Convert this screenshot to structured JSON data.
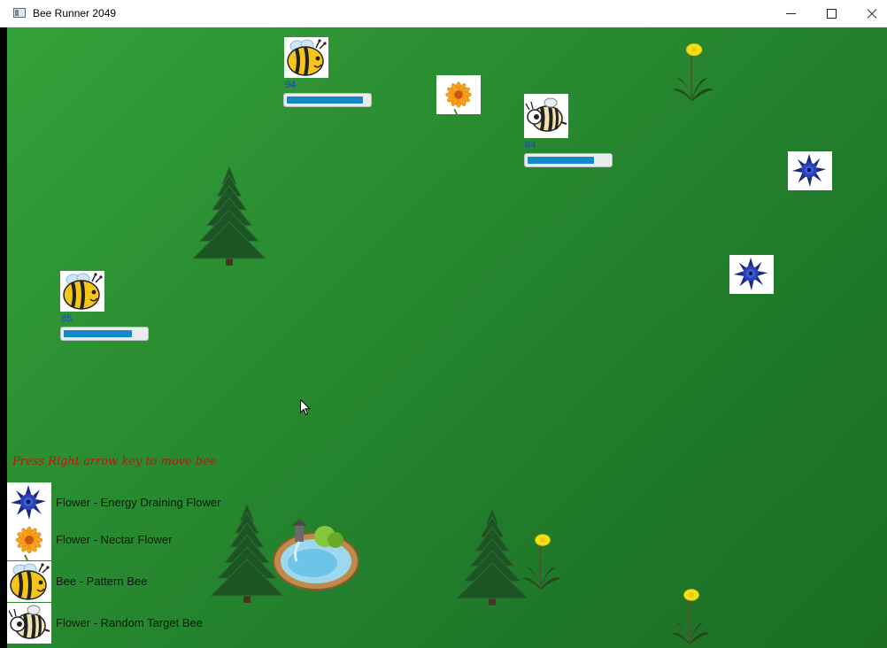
{
  "window": {
    "title": "Bee Runner 2049"
  },
  "bees": [
    {
      "type": "pattern",
      "energy": 94,
      "energy_label": "94",
      "fill": 0.94
    },
    {
      "type": "random-target",
      "energy": 84,
      "energy_label": "84",
      "fill": 0.82
    },
    {
      "type": "pattern",
      "energy": 85,
      "energy_label": "85",
      "fill": 0.84
    }
  ],
  "instruction": "Press Right arrow key to move bee",
  "legend": [
    {
      "icon": "energy-draining-flower-icon",
      "label": "Flower - Energy Draining Flower"
    },
    {
      "icon": "nectar-flower-icon",
      "label": "Flower - Nectar Flower"
    },
    {
      "icon": "pattern-bee-icon",
      "label": "Bee - Pattern Bee"
    },
    {
      "icon": "random-target-bee-icon",
      "label": "Flower - Random Target Bee"
    }
  ],
  "colors": {
    "grass": "#2a8d31",
    "energy_bar": "#1688c8",
    "instruction_text": "#b8180c",
    "energy_label": "#1f3fd0"
  }
}
